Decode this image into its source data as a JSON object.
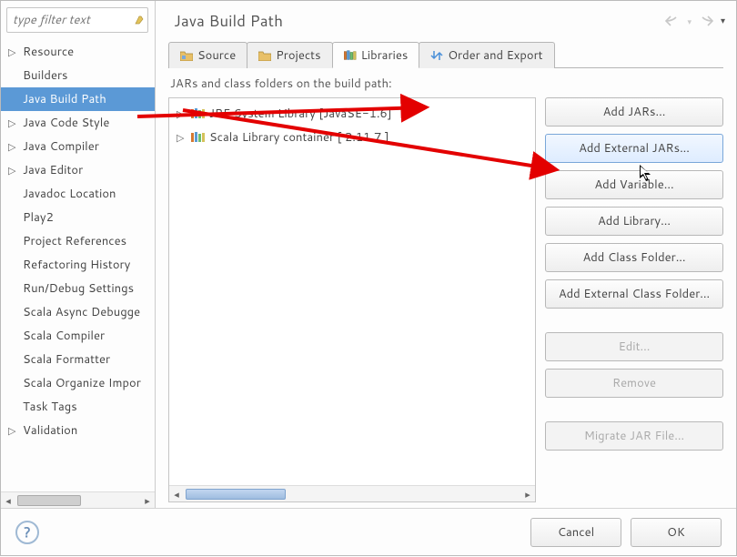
{
  "filter": {
    "placeholder": "type filter text"
  },
  "sidebar": {
    "items": [
      {
        "label": "Resource",
        "expandable": true,
        "selected": false
      },
      {
        "label": "Builders",
        "expandable": false,
        "selected": false
      },
      {
        "label": "Java Build Path",
        "expandable": false,
        "selected": true
      },
      {
        "label": "Java Code Style",
        "expandable": true,
        "selected": false
      },
      {
        "label": "Java Compiler",
        "expandable": true,
        "selected": false
      },
      {
        "label": "Java Editor",
        "expandable": true,
        "selected": false
      },
      {
        "label": "Javadoc Location",
        "expandable": false,
        "selected": false
      },
      {
        "label": "Play2",
        "expandable": false,
        "selected": false
      },
      {
        "label": "Project References",
        "expandable": false,
        "selected": false
      },
      {
        "label": "Refactoring History",
        "expandable": false,
        "selected": false
      },
      {
        "label": "Run/Debug Settings",
        "expandable": false,
        "selected": false
      },
      {
        "label": "Scala Async Debugge",
        "expandable": false,
        "selected": false
      },
      {
        "label": "Scala Compiler",
        "expandable": false,
        "selected": false
      },
      {
        "label": "Scala Formatter",
        "expandable": false,
        "selected": false
      },
      {
        "label": "Scala Organize Impor",
        "expandable": false,
        "selected": false
      },
      {
        "label": "Task Tags",
        "expandable": false,
        "selected": false
      },
      {
        "label": "Validation",
        "expandable": true,
        "selected": false
      }
    ]
  },
  "main": {
    "title": "Java Build Path",
    "tabs": [
      {
        "label": "Source",
        "icon": "source-folder-icon",
        "active": false
      },
      {
        "label": "Projects",
        "icon": "projects-icon",
        "active": false
      },
      {
        "label": "Libraries",
        "icon": "libraries-icon",
        "active": true
      },
      {
        "label": "Order and Export",
        "icon": "order-export-icon",
        "active": false
      }
    ],
    "hint": "JARs and class folders on the build path:",
    "libraries": [
      {
        "label": "JRE System Library [JavaSE-1.6]"
      },
      {
        "label": "Scala Library container [ 2.11.7 ]"
      }
    ],
    "buttons": [
      {
        "label": "Add JARs...",
        "enabled": true,
        "hover": false
      },
      {
        "label": "Add External JARs...",
        "enabled": true,
        "hover": true
      },
      {
        "label": "Add Variable...",
        "enabled": true,
        "hover": false
      },
      {
        "label": "Add Library...",
        "enabled": true,
        "hover": false
      },
      {
        "label": "Add Class Folder...",
        "enabled": true,
        "hover": false
      },
      {
        "label": "Add External Class Folder...",
        "enabled": true,
        "hover": false
      },
      {
        "label": "Edit...",
        "enabled": false,
        "hover": false
      },
      {
        "label": "Remove",
        "enabled": false,
        "hover": false
      },
      {
        "label": "Migrate JAR File...",
        "enabled": false,
        "hover": false
      }
    ]
  },
  "dialog": {
    "help_tooltip": "Help",
    "cancel": "Cancel",
    "ok": "OK"
  },
  "annotation": {
    "arrow_color": "#e30000"
  }
}
